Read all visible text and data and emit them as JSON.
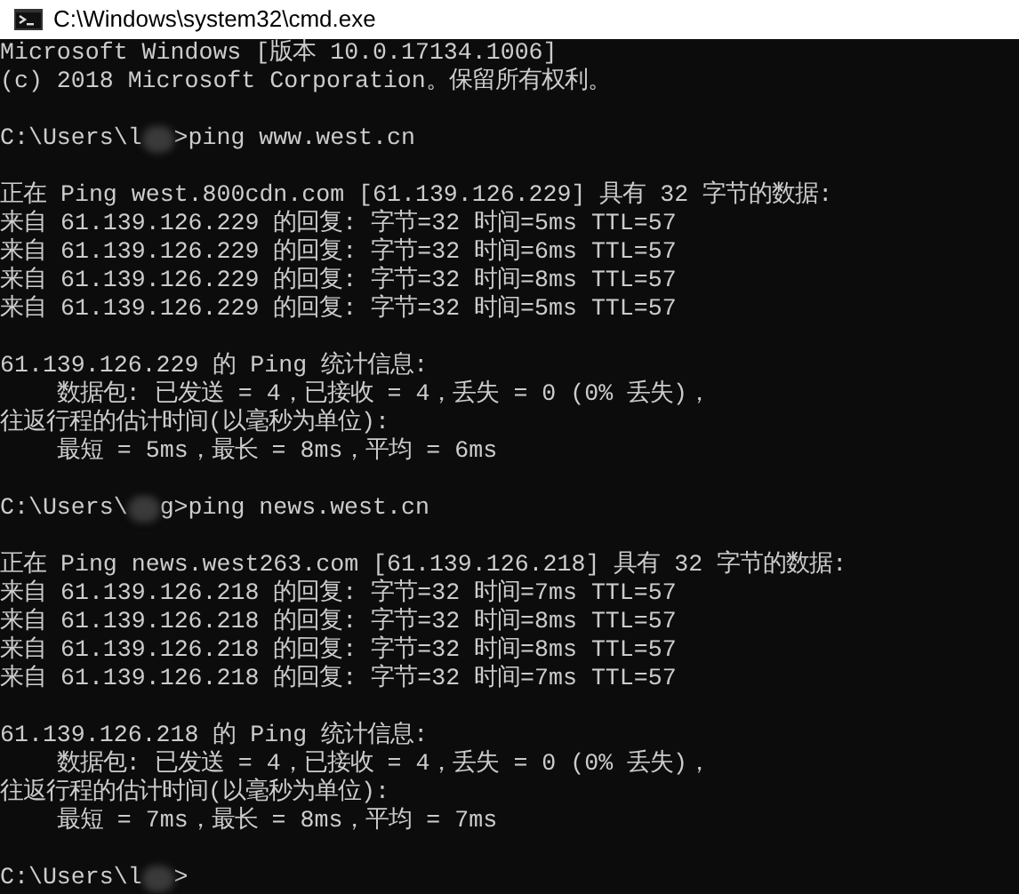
{
  "window": {
    "title": "C:\\Windows\\system32\\cmd.exe"
  },
  "console": {
    "blocks": [
      {
        "lines": [
          {
            "kind": "text",
            "text": "Microsoft Windows [版本 10.0.17134.1006]"
          },
          {
            "kind": "text",
            "text": "(c) 2018 Microsoft Corporation。保留所有权利。"
          }
        ]
      },
      {
        "lines": [
          {
            "kind": "prompt",
            "prefix": "C:\\Users\\l",
            "command": ">ping www.west.cn"
          }
        ]
      },
      {
        "lines": [
          {
            "kind": "text",
            "text": "正在 Ping west.800cdn.com [61.139.126.229] 具有 32 字节的数据:"
          },
          {
            "kind": "text",
            "text": "来自 61.139.126.229 的回复: 字节=32 时间=5ms TTL=57"
          },
          {
            "kind": "text",
            "text": "来自 61.139.126.229 的回复: 字节=32 时间=6ms TTL=57"
          },
          {
            "kind": "text",
            "text": "来自 61.139.126.229 的回复: 字节=32 时间=8ms TTL=57"
          },
          {
            "kind": "text",
            "text": "来自 61.139.126.229 的回复: 字节=32 时间=5ms TTL=57"
          }
        ]
      },
      {
        "lines": [
          {
            "kind": "text",
            "text": "61.139.126.229 的 Ping 统计信息:"
          },
          {
            "kind": "text",
            "text": "    数据包: 已发送 = 4，已接收 = 4，丢失 = 0 (0% 丢失)，"
          },
          {
            "kind": "text",
            "text": "往返行程的估计时间(以毫秒为单位):"
          },
          {
            "kind": "text",
            "text": "    最短 = 5ms，最长 = 8ms，平均 = 6ms"
          }
        ]
      },
      {
        "lines": [
          {
            "kind": "prompt",
            "prefix": "C:\\Users\\",
            "command": "g>ping news.west.cn"
          }
        ]
      },
      {
        "lines": [
          {
            "kind": "text",
            "text": "正在 Ping news.west263.com [61.139.126.218] 具有 32 字节的数据:"
          },
          {
            "kind": "text",
            "text": "来自 61.139.126.218 的回复: 字节=32 时间=7ms TTL=57"
          },
          {
            "kind": "text",
            "text": "来自 61.139.126.218 的回复: 字节=32 时间=8ms TTL=57"
          },
          {
            "kind": "text",
            "text": "来自 61.139.126.218 的回复: 字节=32 时间=8ms TTL=57"
          },
          {
            "kind": "text",
            "text": "来自 61.139.126.218 的回复: 字节=32 时间=7ms TTL=57"
          }
        ]
      },
      {
        "lines": [
          {
            "kind": "text",
            "text": "61.139.126.218 的 Ping 统计信息:"
          },
          {
            "kind": "text",
            "text": "    数据包: 已发送 = 4，已接收 = 4，丢失 = 0 (0% 丢失)，"
          },
          {
            "kind": "text",
            "text": "往返行程的估计时间(以毫秒为单位):"
          },
          {
            "kind": "text",
            "text": "    最短 = 7ms，最长 = 8ms，平均 = 7ms"
          }
        ]
      },
      {
        "lines": [
          {
            "kind": "prompt",
            "prefix": "C:\\Users\\l",
            "command": ">"
          }
        ]
      }
    ]
  }
}
